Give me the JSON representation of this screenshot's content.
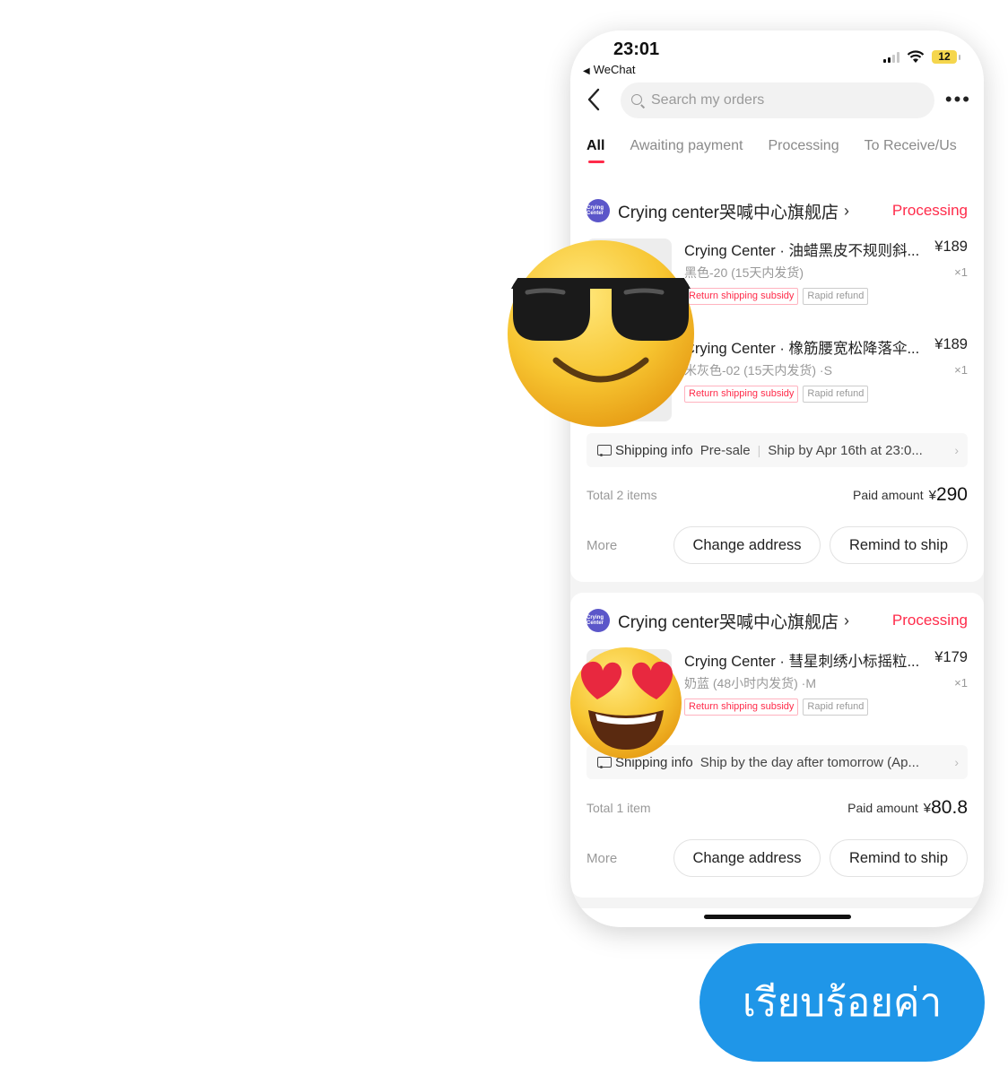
{
  "status_bar": {
    "time": "23:01",
    "back_app": "WeChat",
    "battery": "12"
  },
  "header": {
    "search_placeholder": "Search my orders",
    "more_icon": "more-dots-icon"
  },
  "tabs": [
    {
      "label": "All",
      "active": true
    },
    {
      "label": "Awaiting payment",
      "active": false
    },
    {
      "label": "Processing",
      "active": false
    },
    {
      "label": "To Receive/Us",
      "active": false
    }
  ],
  "orders": [
    {
      "store": "Crying center哭喊中心旗舰店",
      "logo_text": "Crying Center",
      "status": "Processing",
      "items": [
        {
          "title": "Crying Center · 油蜡黑皮不规则斜...",
          "price": "¥189",
          "variant": "黑色-20 (15天内发货)",
          "qty": "×1",
          "tags": [
            "Return shipping subsidy",
            "Rapid refund"
          ]
        },
        {
          "title": "Crying Center · 橡筋腰宽松降落伞...",
          "price": "¥189",
          "variant": "米灰色-02 (15天内发货) ·S",
          "qty": "×1",
          "tags": [
            "Return shipping subsidy",
            "Rapid refund"
          ]
        }
      ],
      "shipping": {
        "label": "Shipping info",
        "presale": "Pre-sale",
        "text": "Ship by Apr 16th at 23:0..."
      },
      "total": "Total 2 items",
      "paid_label": "Paid amount",
      "paid_currency": "¥",
      "paid_value": "290",
      "more": "More",
      "change_address": "Change address",
      "remind": "Remind to ship"
    },
    {
      "store": "Crying center哭喊中心旗舰店",
      "logo_text": "Crying Center",
      "status": "Processing",
      "items": [
        {
          "title": "Crying Center · 彗星刺绣小标摇粒...",
          "price": "¥179",
          "variant": "奶蓝 (48小时内发货) ·M",
          "qty": "×1",
          "tags": [
            "Return shipping subsidy",
            "Rapid refund"
          ]
        }
      ],
      "shipping": {
        "label": "Shipping info",
        "text": "Ship by the day after tomorrow (Ap..."
      },
      "total": "Total 1 item",
      "paid_label": "Paid amount",
      "paid_currency": "¥",
      "paid_value": "80.8",
      "more": "More",
      "change_address": "Change address",
      "remind": "Remind to ship"
    }
  ],
  "overlay": {
    "emoji_1": "sunglasses-emoji",
    "emoji_2": "heart-eyes-emoji",
    "confirm_button": "เรียบร้อยค่า"
  },
  "colors": {
    "accent": "#ff2b4a",
    "button_blue": "#1f96e8"
  }
}
